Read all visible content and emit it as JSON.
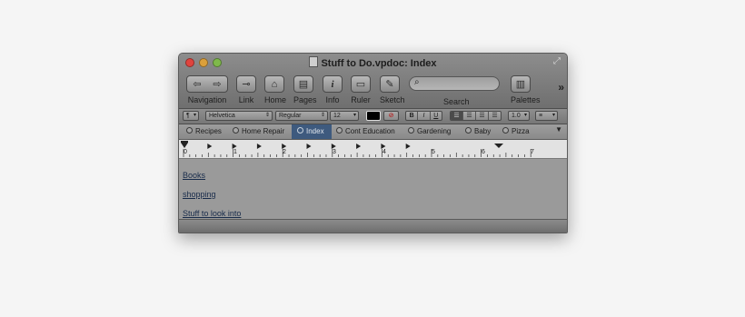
{
  "window": {
    "title": "Stuff to Do.vpdoc: Index"
  },
  "toolbar": {
    "navigation_label": "Navigation",
    "link_label": "Link",
    "home_label": "Home",
    "pages_label": "Pages",
    "info_label": "Info",
    "ruler_label": "Ruler",
    "sketch_label": "Sketch",
    "search_label": "Search",
    "search_value": "",
    "palettes_label": "Palettes",
    "overflow_glyph": "»"
  },
  "formatbar": {
    "paragraph_style": "¶",
    "font_family": "Helvetica",
    "font_style": "Regular",
    "font_size": "12",
    "text_color": "#000000",
    "bold": "B",
    "italic": "I",
    "underline": "U",
    "line_spacing": "1.0",
    "list_style": "≡"
  },
  "tabs": [
    {
      "label": "Recipes",
      "active": false
    },
    {
      "label": "Home Repair",
      "active": false
    },
    {
      "label": "Index",
      "active": true
    },
    {
      "label": "Cont Education",
      "active": false
    },
    {
      "label": "Gardening",
      "active": false
    },
    {
      "label": "Baby",
      "active": false
    },
    {
      "label": "Pizza",
      "active": false
    }
  ],
  "ruler": {
    "numbers": [
      "0",
      "1",
      "2",
      "3",
      "4",
      "5",
      "6",
      "7"
    ]
  },
  "content": {
    "links": [
      "Books",
      "shopping",
      "Stuff to look into"
    ]
  },
  "colors": {
    "window_bg": "#9a9a9a",
    "active_tab": "#3e5a7e",
    "link": "#182b4a"
  }
}
